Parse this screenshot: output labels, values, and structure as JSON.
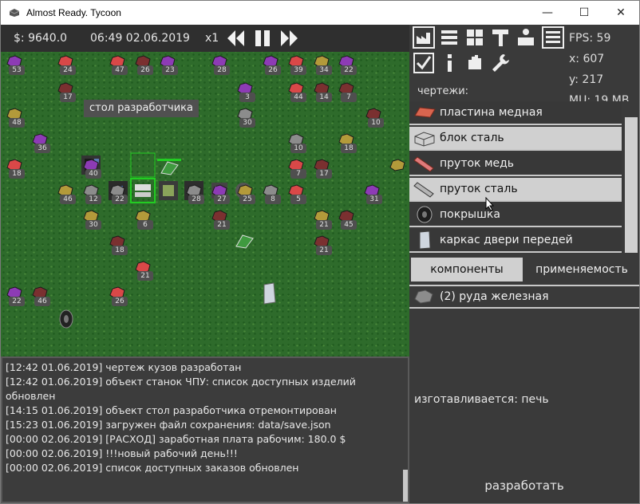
{
  "window": {
    "title": "Almost Ready. Tycoon"
  },
  "window_controls": {
    "minimize": "—",
    "maximize": "☐",
    "close": "✕"
  },
  "topbar": {
    "money": "$: 9640.0",
    "datetime": "06:49 02.06.2019",
    "speed": "x1"
  },
  "stats": {
    "fps": "FPS: 59",
    "x": "x: 607",
    "y": "y: 217",
    "mu": "MU: 19 MB"
  },
  "tooltip": "стол разработчика",
  "ores": [
    {
      "n": "53",
      "c": "#8d3bb5"
    },
    {
      "n": "24",
      "c": "#d94848"
    },
    {
      "n": "47",
      "c": "#d94848"
    },
    {
      "n": "26",
      "c": "#7a3030"
    },
    {
      "n": "23",
      "c": "#8d3bb5"
    },
    {
      "n": "28",
      "c": "#8d3bb5"
    },
    {
      "n": "26",
      "c": "#8d3bb5"
    },
    {
      "n": "39",
      "c": "#d94848"
    },
    {
      "n": "34",
      "c": "#b39a3a"
    },
    {
      "n": "22",
      "c": "#8d3bb5"
    },
    {
      "n": "17",
      "c": "#7a3030"
    },
    {
      "n": "3",
      "c": "#8d3bb5"
    },
    {
      "n": "44",
      "c": "#d94848"
    },
    {
      "n": "14",
      "c": "#7a3030"
    },
    {
      "n": "7",
      "c": "#7a3030"
    },
    {
      "n": "48",
      "c": "#b39a3a"
    },
    {
      "n": "30",
      "c": "#8c8c8c"
    },
    {
      "n": "10",
      "c": "#7a3030"
    },
    {
      "n": "36",
      "c": "#8d3bb5"
    },
    {
      "n": "10",
      "c": "#8c8c8c"
    },
    {
      "n": "18",
      "c": "#b39a3a"
    },
    {
      "n": "18",
      "c": "#d94848"
    },
    {
      "n": "40",
      "c": "#8d3bb5"
    },
    {
      "n": "7",
      "c": "#d94848"
    },
    {
      "n": "17",
      "c": "#7a3030"
    },
    {
      "n": "",
      "c": "#b39a3a"
    },
    {
      "n": "46",
      "c": "#b39a3a"
    },
    {
      "n": "12",
      "c": "#8c8c8c"
    },
    {
      "n": "22",
      "c": "#8c8c8c"
    },
    {
      "n": "28",
      "c": "#8c8c8c"
    },
    {
      "n": "27",
      "c": "#8d3bb5"
    },
    {
      "n": "25",
      "c": "#b39a3a"
    },
    {
      "n": "8",
      "c": "#8c8c8c"
    },
    {
      "n": "5",
      "c": "#d94848"
    },
    {
      "n": "31",
      "c": "#8d3bb5"
    },
    {
      "n": "30",
      "c": "#b39a3a"
    },
    {
      "n": "6",
      "c": "#b39a3a"
    },
    {
      "n": "21",
      "c": "#7a3030"
    },
    {
      "n": "21",
      "c": "#b39a3a"
    },
    {
      "n": "45",
      "c": "#7a3030"
    },
    {
      "n": "18",
      "c": "#7a3030"
    },
    {
      "n": "21",
      "c": "#7a3030"
    },
    {
      "n": "21",
      "c": "#d94848"
    },
    {
      "n": "22",
      "c": "#8d3bb5"
    },
    {
      "n": "46",
      "c": "#7a3030"
    },
    {
      "n": "26",
      "c": "#d94848"
    }
  ],
  "log": [
    "[12:42 01.06.2019] чертеж кузов разработан",
    "[12:42 01.06.2019] объект станок ЧПУ: список доступных изделий",
    "обновлен",
    "[14:15 01.06.2019] объект стол разработчика отремонтирован",
    "[15:23 01.06.2019] загружен файл сохранения: data/save.json",
    "[00:00 02.06.2019] [РАСХОД] заработная плата рабочим: 180.0 $",
    "[00:00 02.06.2019] !!!новый рабочий день!!!",
    "[00:00 02.06.2019] список доступных заказов обновлен"
  ],
  "drafts": {
    "label": "чертежи:",
    "items": [
      {
        "label": "пластина медная",
        "icon": "copper-plate-icon"
      },
      {
        "label": "блок сталь",
        "icon": "steel-block-icon"
      },
      {
        "label": "пруток медь",
        "icon": "copper-rod-icon"
      },
      {
        "label": "пруток сталь",
        "icon": "steel-rod-icon"
      },
      {
        "label": "покрышка",
        "icon": "tire-icon"
      },
      {
        "label": "каркас двери передей",
        "icon": "door-frame-icon"
      }
    ]
  },
  "tabs": {
    "components": "компоненты",
    "usage": "применяемость"
  },
  "component": "(2) руда железная",
  "made_by": "изготавливается: печь",
  "develop": "разработать",
  "colors": {
    "panel": "#3a3a3a",
    "light_row": "#d0d0d0",
    "grass": "#2e6b2b",
    "highlight": "#22cc22"
  }
}
